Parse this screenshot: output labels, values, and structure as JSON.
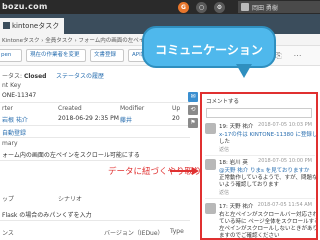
{
  "app": {
    "logo": "bozu.com",
    "user_name": "岡田 勇樹"
  },
  "app_tab": {
    "label": "kintoneタスク"
  },
  "breadcrumb": "Kintoneタスク › 全員タスク › フォーム内の画面の左ペインをスクロール可能にする",
  "toolbar": {
    "open_label": "pen",
    "assignee_label": "現在の作業者を変更",
    "document_label": "文書登録",
    "api_label": "API設定"
  },
  "record": {
    "status_prefix": "ータス:",
    "status_value": "Closed",
    "status_history": "ステータスの履歴",
    "key_label": "nt Key",
    "key_value": "ONE-11347",
    "reporter_label": "rter",
    "reporter_value": "岩根 祐介",
    "created_label": "Created",
    "created_value": "2018-06-29 2:35 PM",
    "modifier_label": "Modifier",
    "modifier_value": "藤井",
    "updated_label": "Up",
    "updated_value": "20",
    "link_text": "自動登録",
    "summary_label": "mary",
    "summary_value": "ォーム内の画面の左ペインをスクロール可能にする",
    "preconditions_label": "ップ",
    "scenario_label": "シナリオ",
    "extra_text": "Flask の場合のみパンくずを入力",
    "footer_label": "ンス",
    "footer_version": "バージョン（IEDue）",
    "footer_type": "Type"
  },
  "comments": {
    "header": "コメントする",
    "items": [
      {
        "who": "19: 天野 祐介",
        "time": "2018-07-05 10:03 PM",
        "lines": [
          "x-17の件は KINTONE-11380 に登録しま",
          "した"
        ],
        "like": "返信"
      },
      {
        "who": "18: 岩川 英",
        "time": "2018-07-05 10:00 PM",
        "lines": [
          "@天野 祐介 りまs を見ておりますか",
          "正常動作しているようで、すが、問題な",
          "いよう確認しております"
        ],
        "like": "返信"
      },
      {
        "who": "17: 天野 祐介",
        "time": "2018-07-05 11:54 AM",
        "lines": [
          "右と左ペインがスクロールバー対応され",
          "ている時に ページ全体をスクロールすると",
          "左ペインがスクロールしないときがあり",
          "ますのでご確認ください"
        ],
        "like": "返信"
      }
    ]
  },
  "annotations": {
    "bubble_text": "コミュニケーション",
    "callout_text": "データに紐づくやり取り"
  },
  "colors": {
    "topbar": "#2a2a2a",
    "subbar": "#3b4d5c",
    "highlight": "#e03030",
    "bubble": "#4fb8ec",
    "link": "#2a6fb0"
  }
}
